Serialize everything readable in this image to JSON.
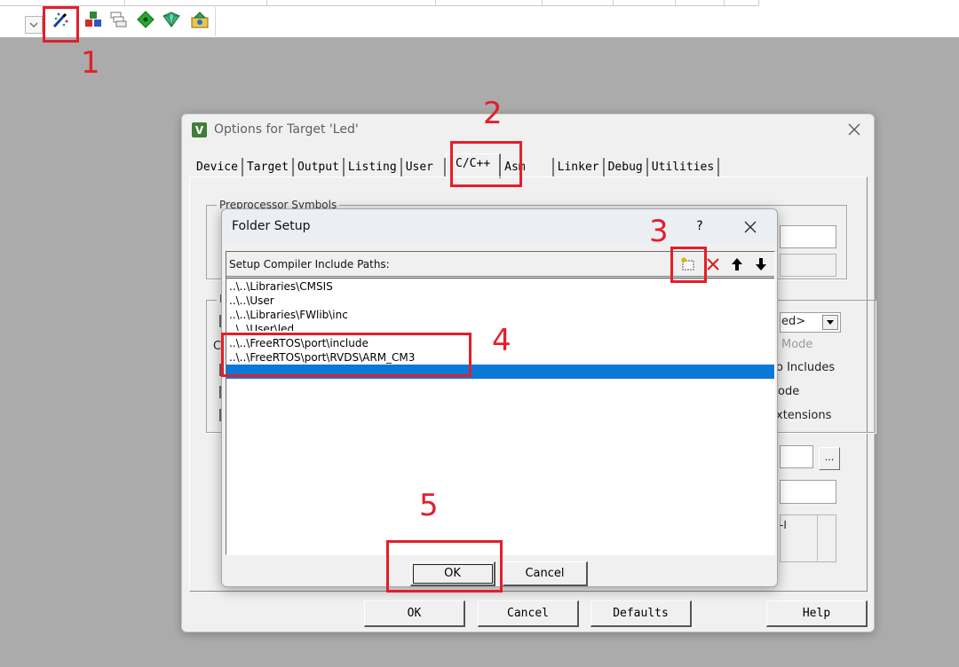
{
  "toolbar": {
    "buttons": [
      {
        "icon": "magic-wand-options-icon"
      },
      {
        "icon": "components-icon"
      },
      {
        "icon": "manage-stack-icon"
      },
      {
        "icon": "green-diamond-icon"
      },
      {
        "icon": "pack-installer-icon"
      },
      {
        "icon": "pack-manager-icon"
      }
    ]
  },
  "annotations": {
    "color": "#e41e2b",
    "steps": [
      "1",
      "2",
      "3",
      "4",
      "5"
    ]
  },
  "options_dialog": {
    "icon_letter": "V",
    "title": "Options for Target 'Led'",
    "tabs": [
      "Device",
      "Target",
      "Output",
      "Listing",
      "User",
      "C/C++",
      "Asm",
      "Linker",
      "Debug",
      "Utilities"
    ],
    "active_tab": "C/C++",
    "group_preprocessor_label": "Preprocessor Symbols",
    "group_language_label": "L",
    "partial_label_c": "C",
    "partial_label_other": "O",
    "right_combo_text": "ed>",
    "right_mode_text": "Mode",
    "right_includes_text": "o Includes",
    "right_code_text": "ode",
    "right_extensions_text": "xtensions",
    "ellipsis_label": "...",
    "misc_text": "-I",
    "buttons": {
      "ok": "OK",
      "cancel": "Cancel",
      "defaults": "Defaults",
      "help": "Help"
    }
  },
  "folder_setup": {
    "title": "Folder Setup",
    "help_label": "?",
    "list_header": "Setup Compiler Include Paths:",
    "tools": [
      {
        "icon": "new-folder-icon"
      },
      {
        "icon": "delete-x-icon"
      },
      {
        "icon": "move-up-arrow-icon"
      },
      {
        "icon": "move-down-arrow-icon"
      }
    ],
    "paths": [
      "..\\..\\Libraries\\CMSIS",
      "..\\..\\User",
      "..\\..\\Libraries\\FWlib\\inc",
      "..\\..\\User\\led",
      "..\\..\\FreeRTOS\\port\\include",
      "..\\..\\FreeRTOS\\port\\RVDS\\ARM_CM3"
    ],
    "selection_color": "#0a78d7",
    "buttons": {
      "ok": "OK",
      "cancel": "Cancel"
    }
  }
}
